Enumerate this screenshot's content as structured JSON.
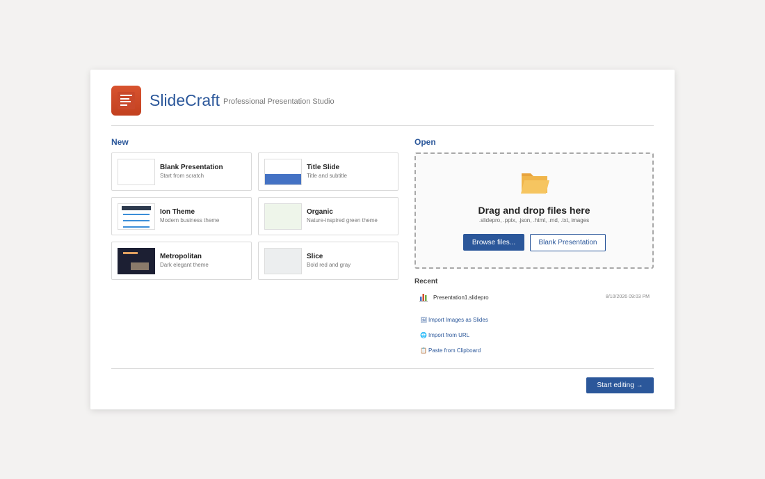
{
  "app": {
    "title": "SlideCraft",
    "subtitle": "Professional Presentation Studio",
    "brand_color": "#2b579a",
    "logo_color": "#d04e2c"
  },
  "new_section": {
    "label": "New",
    "templates": [
      {
        "title": "Blank Presentation",
        "description": "Start from scratch"
      },
      {
        "title": "Title Slide",
        "description": "Title and subtitle"
      },
      {
        "title": "Ion Theme",
        "description": "Modern business theme"
      },
      {
        "title": "Organic",
        "description": "Nature-inspired green theme"
      },
      {
        "title": "Metropolitan",
        "description": "Dark elegant theme"
      },
      {
        "title": "Slice",
        "description": "Bold red and gray"
      }
    ]
  },
  "open_section": {
    "label": "Open",
    "dropzone": {
      "icon": "folder-open-icon",
      "title": "Drag and drop files here",
      "formats": ".slidepro, .pptx, .json, .html, .md, .txt, images",
      "browse_label": "Browse files...",
      "blank_label": "Blank Presentation"
    },
    "recent_label": "Recent",
    "recent": [
      {
        "icon": "chart-icon",
        "name": "Presentation1.slidepro",
        "date": "8/10/2026 09:03 PM"
      }
    ],
    "links": [
      {
        "icon": "image-icon",
        "label": "Import Images as Slides"
      },
      {
        "icon": "globe-icon",
        "label": "Import from URL"
      },
      {
        "icon": "clipboard-icon",
        "label": "Paste from Clipboard"
      }
    ]
  },
  "footer": {
    "start_label": "Start editing →"
  }
}
